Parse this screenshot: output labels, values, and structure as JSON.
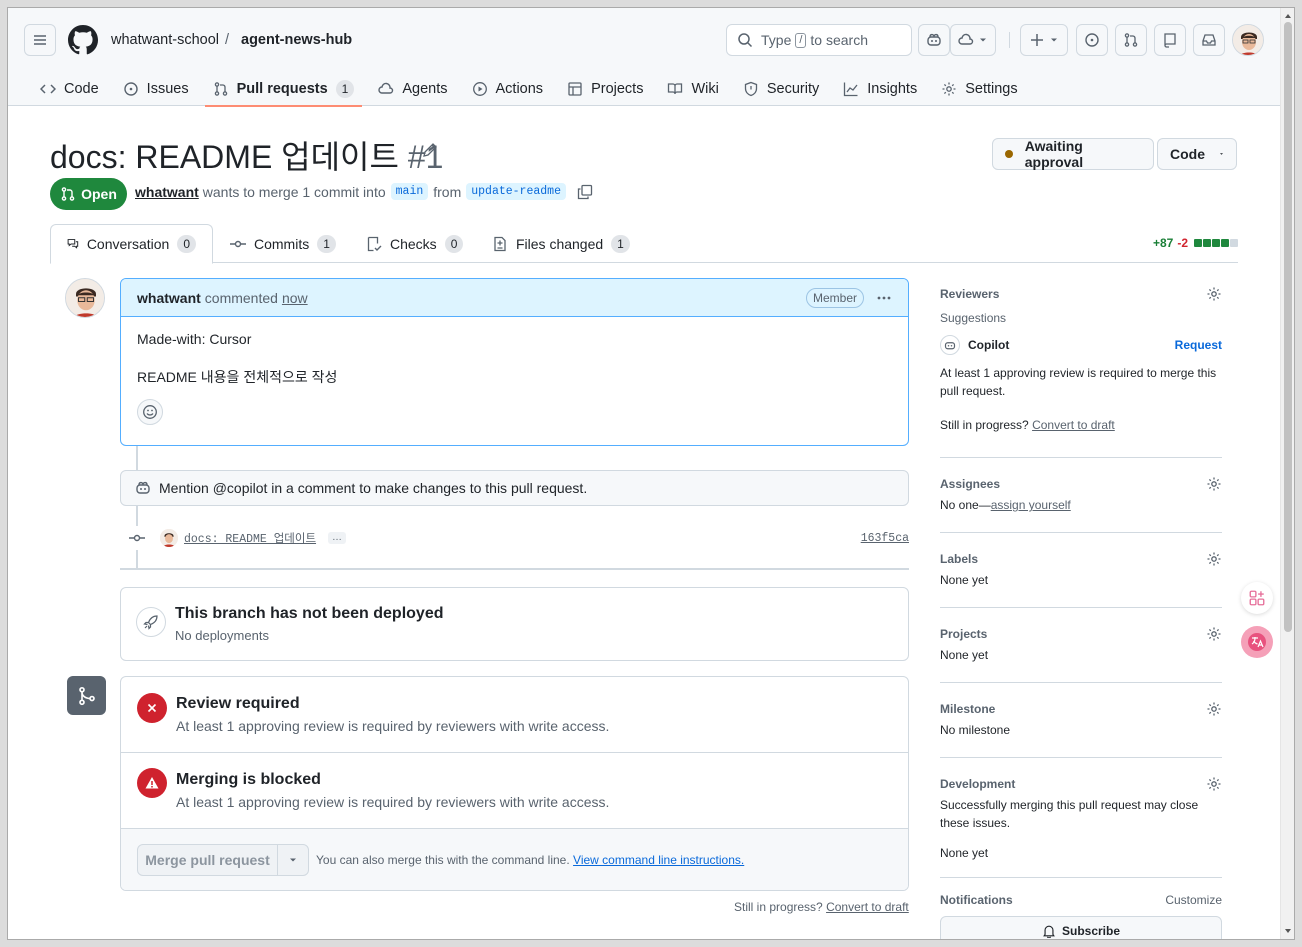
{
  "header": {
    "owner": "whatwant-school",
    "separator": "/",
    "repo": "agent-news-hub",
    "search_placeholder_pre": "Type",
    "search_key": "/",
    "search_placeholder_post": "to search"
  },
  "repo_tabs": [
    {
      "label": "Code",
      "icon": "code-icon"
    },
    {
      "label": "Issues",
      "icon": "issue-icon"
    },
    {
      "label": "Pull requests",
      "icon": "pull-request-icon",
      "count": "1",
      "selected": true
    },
    {
      "label": "Agents",
      "icon": "agent-icon"
    },
    {
      "label": "Actions",
      "icon": "play-icon"
    },
    {
      "label": "Projects",
      "icon": "table-icon"
    },
    {
      "label": "Wiki",
      "icon": "book-icon"
    },
    {
      "label": "Security",
      "icon": "shield-icon"
    },
    {
      "label": "Insights",
      "icon": "graph-icon"
    },
    {
      "label": "Settings",
      "icon": "gear-icon"
    }
  ],
  "pr": {
    "title": "docs: README 업데이트",
    "number": "#1",
    "state": "Open",
    "author": "whatwant",
    "merge_text": "wants to merge 1 commit into",
    "base": "main",
    "from": "from",
    "head": "update-readme",
    "awaiting_label": "Awaiting approval",
    "code_label": "Code"
  },
  "pr_tabs": [
    {
      "label": "Conversation",
      "count": "0"
    },
    {
      "label": "Commits",
      "count": "1"
    },
    {
      "label": "Checks",
      "count": "0"
    },
    {
      "label": "Files changed",
      "count": "1"
    }
  ],
  "diffstat": {
    "add": "+87",
    "del": "-2"
  },
  "comment": {
    "author": "whatwant",
    "action": "commented",
    "time": "now",
    "role": "Member",
    "line1": "Made-with: Cursor",
    "line2": "README 내용을 전체적으로 작성"
  },
  "copilot_hint": "Mention @copilot in a comment to make changes to this pull request.",
  "commit": {
    "message": "docs: README 업데이트",
    "ellipsis": "…",
    "sha": "163f5ca"
  },
  "deploy": {
    "title": "This branch has not been deployed",
    "subtitle": "No deployments"
  },
  "merge": {
    "review_title": "Review required",
    "review_desc": "At least 1 approving review is required by reviewers with write access.",
    "blocked_title": "Merging is blocked",
    "blocked_desc": "At least 1 approving review is required by reviewers with write access.",
    "merge_btn": "Merge pull request",
    "cli_text": "You can also merge this with the command line.",
    "cli_link": "View command line instructions."
  },
  "footer": {
    "draft_prefix": "Still in progress?",
    "draft_link": "Convert to draft"
  },
  "sidebar": {
    "reviewers": {
      "title": "Reviewers",
      "suggestions": "Suggestions",
      "copilot": "Copilot",
      "request": "Request",
      "note": "At least 1 approving review is required to merge this pull request.",
      "still": "Still in progress?",
      "draft": "Convert to draft"
    },
    "assignees": {
      "title": "Assignees",
      "value": "No one—",
      "link": "assign yourself"
    },
    "labels": {
      "title": "Labels",
      "value": "None yet"
    },
    "projects": {
      "title": "Projects",
      "value": "None yet"
    },
    "milestone": {
      "title": "Milestone",
      "value": "No milestone"
    },
    "development": {
      "title": "Development",
      "desc": "Successfully merging this pull request may close these issues.",
      "value": "None yet"
    },
    "notifications": {
      "title": "Notifications",
      "customize": "Customize",
      "subscribe": "Subscribe"
    }
  },
  "colors": {
    "accent": "#0969da",
    "open": "#1f883d",
    "danger": "#cf222e",
    "tab_underline": "#fd8c73"
  }
}
